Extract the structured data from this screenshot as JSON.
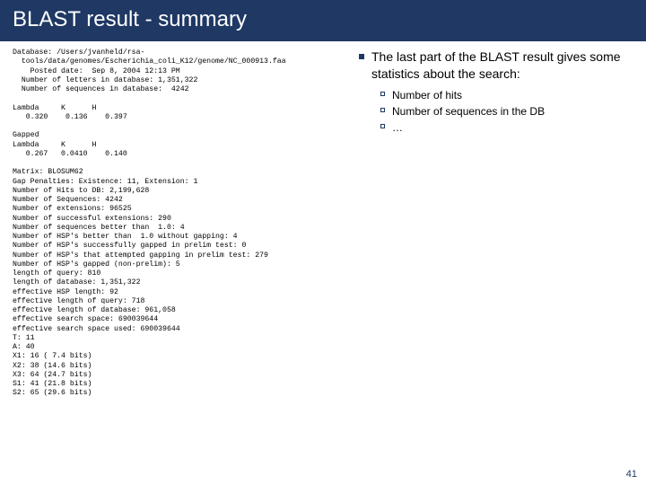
{
  "title": "BLAST result - summary",
  "blast_output": "Database: /Users/jvanheld/rsa-\n  tools/data/genomes/Escherichia_coli_K12/genome/NC_000913.faa\n    Posted date:  Sep 8, 2004 12:13 PM\n  Number of letters in database: 1,351,322\n  Number of sequences in database:  4242\n\nLambda     K      H\n   0.320    0.136    0.397\n\nGapped\nLambda     K      H\n   0.267   0.0410    0.140\n\nMatrix: BLOSUM62\nGap Penalties: Existence: 11, Extension: 1\nNumber of Hits to DB: 2,199,628\nNumber of Sequences: 4242\nNumber of extensions: 96525\nNumber of successful extensions: 290\nNumber of sequences better than  1.0: 4\nNumber of HSP's better than  1.0 without gapping: 4\nNumber of HSP's successfully gapped in prelim test: 0\nNumber of HSP's that attempted gapping in prelim test: 279\nNumber of HSP's gapped (non-prelim): 5\nlength of query: 810\nlength of database: 1,351,322\neffective HSP length: 92\neffective length of query: 718\neffective length of database: 961,058\neffective search space: 690039644\neffective search space used: 690039644\nT: 11\nA: 40\nX1: 16 ( 7.4 bits)\nX2: 38 (14.6 bits)\nX3: 64 (24.7 bits)\nS1: 41 (21.8 bits)\nS2: 65 (29.6 bits)",
  "summary": {
    "intro": "The last part of the BLAST result gives some statistics about the search:",
    "items": [
      "Number of hits",
      "Number of sequences in the DB",
      "…"
    ]
  },
  "page_number": "41"
}
